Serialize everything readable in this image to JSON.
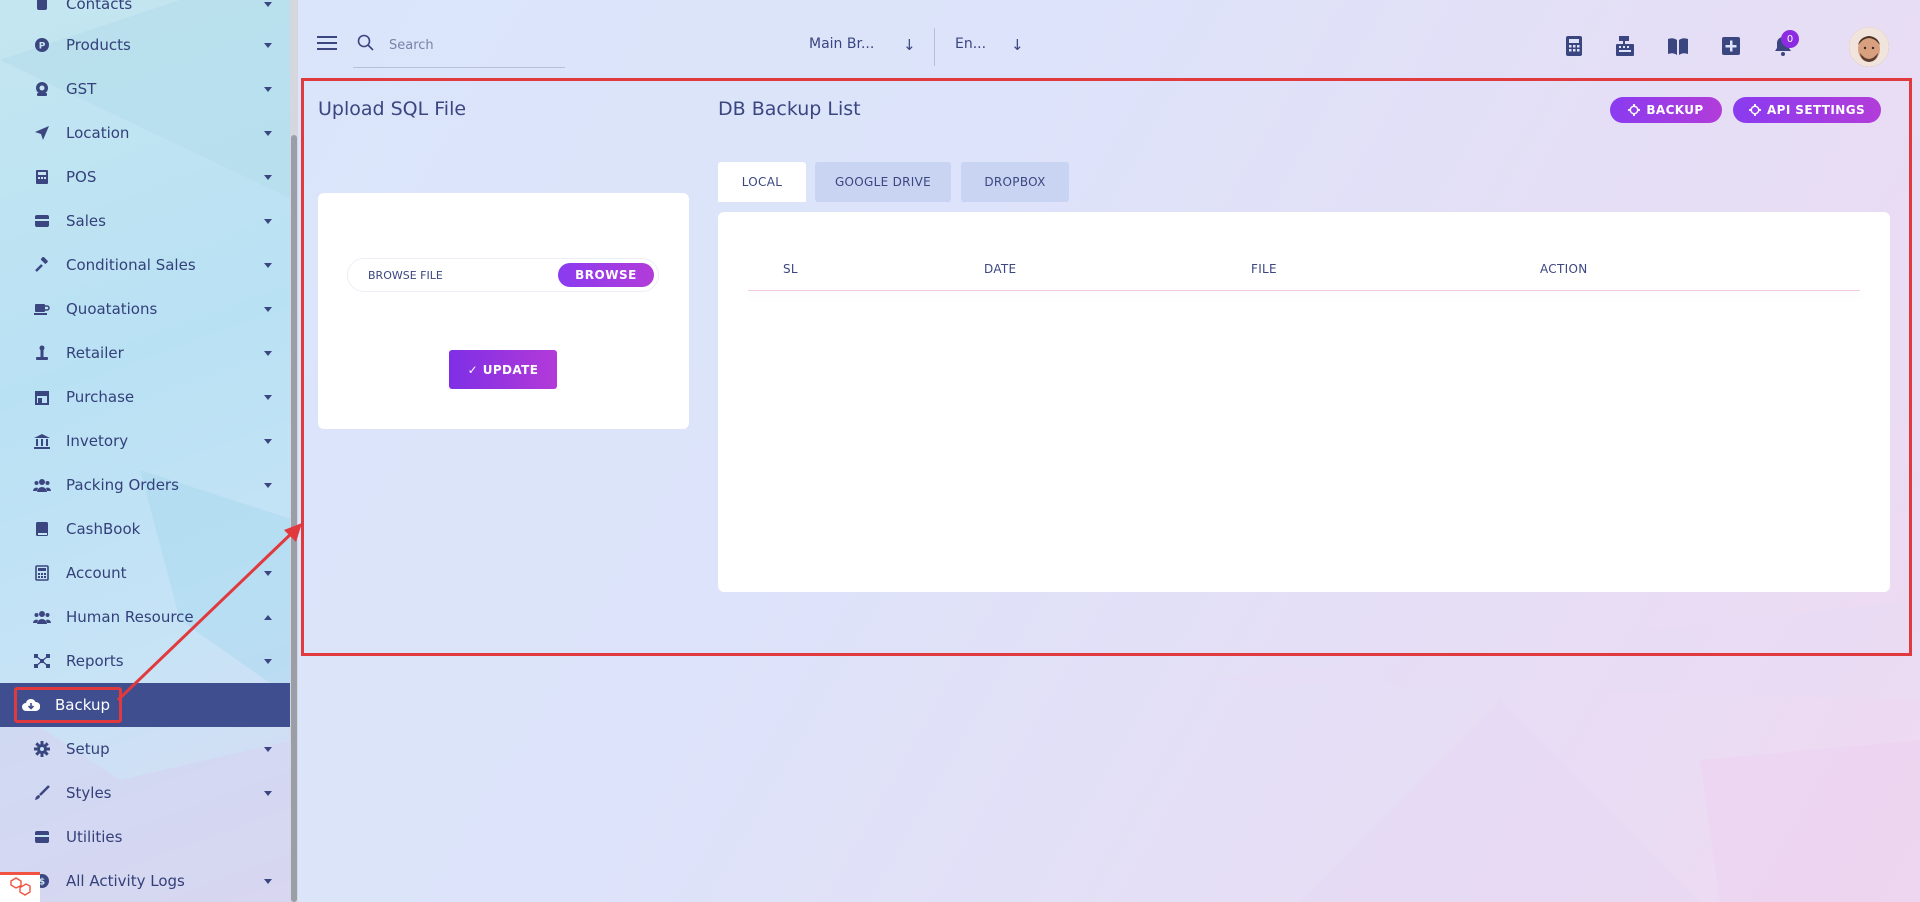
{
  "sidebar": {
    "items": [
      {
        "label": "Contacts",
        "icon": "contacts-icon",
        "caret": "down"
      },
      {
        "label": "Products",
        "icon": "products-icon",
        "caret": "down"
      },
      {
        "label": "GST",
        "icon": "gst-icon",
        "caret": "down"
      },
      {
        "label": "Location",
        "icon": "location-arrow-icon",
        "caret": "down"
      },
      {
        "label": "POS",
        "icon": "pos-icon",
        "caret": "down"
      },
      {
        "label": "Sales",
        "icon": "sales-icon",
        "caret": "down"
      },
      {
        "label": "Conditional Sales",
        "icon": "gavel-icon",
        "caret": "down"
      },
      {
        "label": "Quoatations",
        "icon": "coffee-cup-icon",
        "caret": "down"
      },
      {
        "label": "Retailer",
        "icon": "retailer-icon",
        "caret": "down"
      },
      {
        "label": "Purchase",
        "icon": "store-icon",
        "caret": "down"
      },
      {
        "label": "Invetory",
        "icon": "bank-icon",
        "caret": "down"
      },
      {
        "label": "Packing Orders",
        "icon": "users-icon",
        "caret": "down"
      },
      {
        "label": "CashBook",
        "icon": "book-icon",
        "caret": ""
      },
      {
        "label": "Account",
        "icon": "calculator-icon",
        "caret": "down"
      },
      {
        "label": "Human Resource",
        "icon": "users-icon",
        "caret": "up"
      },
      {
        "label": "Reports",
        "icon": "chart-nodes-icon",
        "caret": "down"
      },
      {
        "label": "Backup",
        "icon": "cloud-download-icon",
        "caret": ""
      },
      {
        "label": "Setup",
        "icon": "gear-icon",
        "caret": "down"
      },
      {
        "label": "Styles",
        "icon": "brush-icon",
        "caret": "down"
      },
      {
        "label": "Utilities",
        "icon": "utilities-icon",
        "caret": ""
      },
      {
        "label": "All Activity Logs",
        "icon": "activity-icon",
        "caret": "down"
      }
    ]
  },
  "topbar": {
    "search_placeholder": "Search",
    "branch_select": "Main Br...",
    "language_select": "En...",
    "notification_count": "0"
  },
  "upload": {
    "title": "Upload SQL File",
    "file_label": "BROWSE FILE",
    "browse_label": "BROWSE",
    "update_label": "✓ UPDATE"
  },
  "backup_list": {
    "title": "DB Backup List",
    "backup_label": "BACKUP",
    "api_label": "API SETTINGS",
    "tabs": [
      "LOCAL",
      "GOOGLE DRIVE",
      "DROPBOX"
    ],
    "columns": [
      "SL",
      "DATE",
      "FILE",
      "ACTION"
    ]
  },
  "colors": {
    "accent": "#8a3bf0",
    "active_nav": "#3f4e8f",
    "highlight": "#e03a3e"
  }
}
